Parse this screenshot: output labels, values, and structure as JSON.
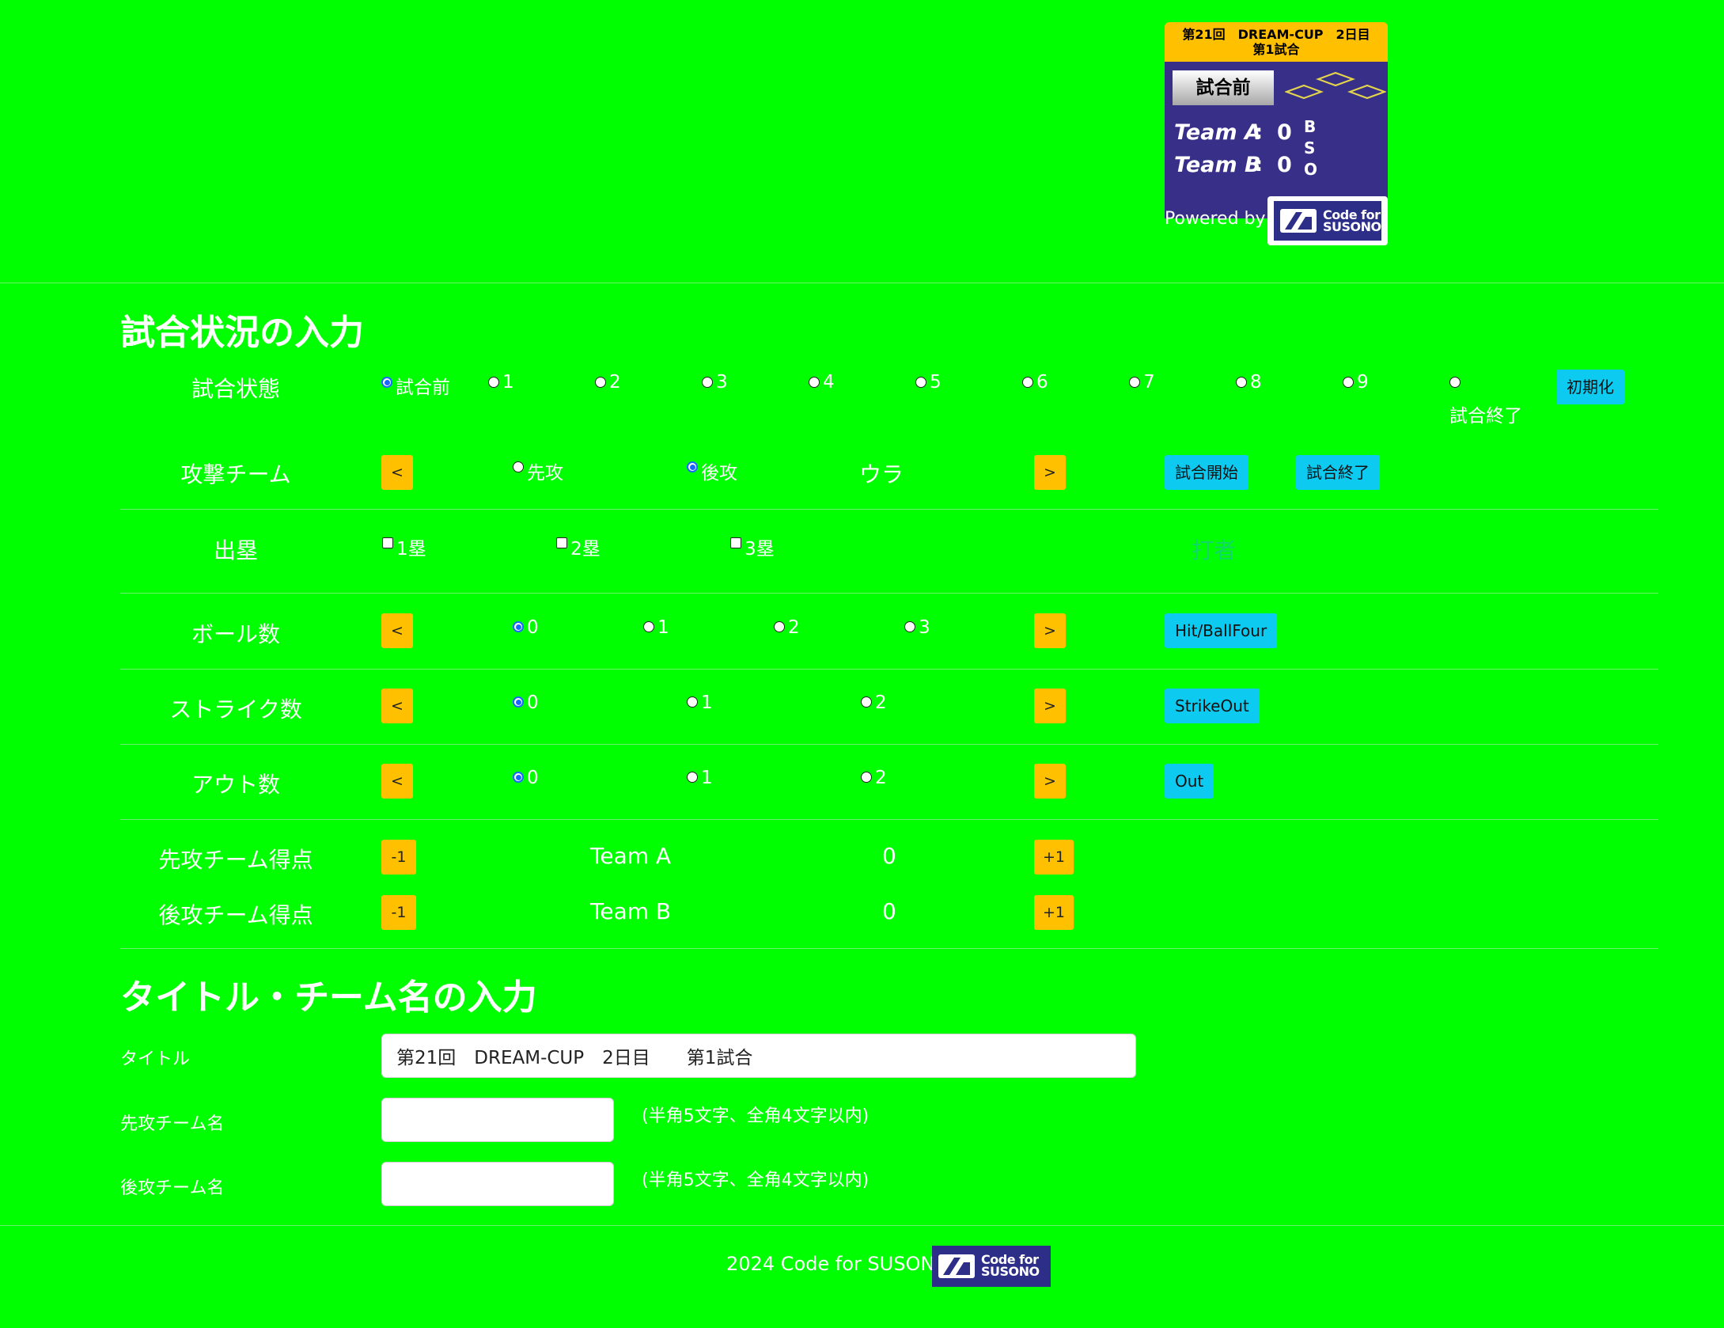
{
  "scoreboard": {
    "title_line1": "第21回　DREAM-CUP　2日目",
    "title_line2": "第1試合",
    "status": "試合前",
    "team_a": "Team A",
    "team_b": "Team B",
    "colon": ":",
    "score_a": "0",
    "score_b": "0",
    "bso": [
      "B",
      "S",
      "O"
    ],
    "powered_by": "Powered by",
    "logo_line1": "Code for",
    "logo_line2": "SUSONO"
  },
  "colors": {
    "background": "#00ff00",
    "scoreboard_header": "#ffc000",
    "scoreboard_body": "#383088",
    "button_yellow": "#ffc000",
    "button_cyan": "#0dcaf0",
    "logo_blue": "#2c2e87"
  },
  "section1": {
    "heading": "試合状況の入力",
    "game_state": {
      "label": "試合状態",
      "options": [
        "試合前",
        "1",
        "2",
        "3",
        "4",
        "5",
        "6",
        "7",
        "8",
        "9",
        "試合終了"
      ],
      "selected": "試合前",
      "reset_button": "初期化"
    },
    "attack": {
      "label": "攻撃チーム",
      "prev": "<",
      "next": ">",
      "options": [
        "先攻",
        "後攻"
      ],
      "selected": "後攻",
      "half": "ウラ",
      "start_button": "試合開始",
      "end_button": "試合終了"
    },
    "runners": {
      "label": "出塁",
      "options": [
        "1塁",
        "2塁",
        "3塁"
      ],
      "batter": "打者"
    },
    "balls": {
      "label": "ボール数",
      "prev": "<",
      "next": ">",
      "options": [
        "0",
        "1",
        "2",
        "3"
      ],
      "selected": "0",
      "action": "Hit/BallFour"
    },
    "strikes": {
      "label": "ストライク数",
      "prev": "<",
      "next": ">",
      "options": [
        "0",
        "1",
        "2"
      ],
      "selected": "0",
      "action": "StrikeOut"
    },
    "outs": {
      "label": "アウト数",
      "prev": "<",
      "next": ">",
      "options": [
        "0",
        "1",
        "2"
      ],
      "selected": "0",
      "action": "Out"
    },
    "top_score": {
      "label": "先攻チーム得点",
      "minus": "-1",
      "team": "Team A",
      "score": "0",
      "plus": "+1"
    },
    "bottom_score": {
      "label": "後攻チーム得点",
      "minus": "-1",
      "team": "Team B",
      "score": "0",
      "plus": "+1"
    }
  },
  "section2": {
    "heading": "タイトル・チーム名の入力",
    "title_label": "タイトル",
    "title_value": "第21回　DREAM-CUP　2日目　　第1試合",
    "first_team_label": "先攻チーム名",
    "first_team_value": "",
    "second_team_label": "後攻チーム名",
    "second_team_value": "",
    "hint": "(半角5文字、全角4文字以内)"
  },
  "footer": {
    "text": "2024 Code for SUSONO",
    "logo_line1": "Code for",
    "logo_line2": "SUSONO"
  }
}
